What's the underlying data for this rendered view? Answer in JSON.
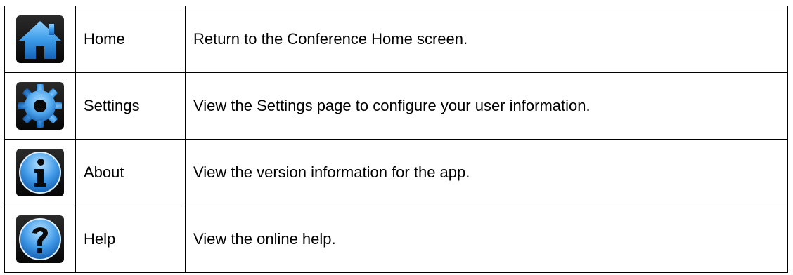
{
  "rows": [
    {
      "icon": "home-icon",
      "label": "Home",
      "description": "Return to the Conference Home screen."
    },
    {
      "icon": "gear-icon",
      "label": "Settings",
      "description": "View the Settings page to configure your user information."
    },
    {
      "icon": "info-icon",
      "label": "About",
      "description": "View the version information for the app."
    },
    {
      "icon": "help-icon",
      "label": "Help",
      "description": "View the online help."
    }
  ],
  "colors": {
    "icon_blue": "#3a8ee6",
    "icon_background": "#0a0a0a",
    "border": "#000000"
  }
}
